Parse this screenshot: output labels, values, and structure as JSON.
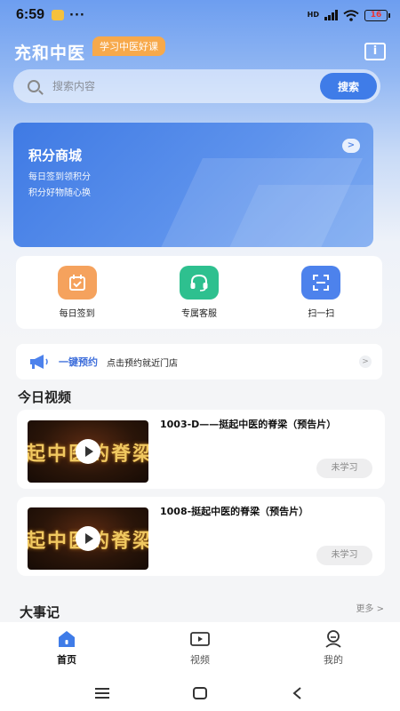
{
  "status_bar": {
    "time": "6:59",
    "dots": "···",
    "network": "HD",
    "battery": "16"
  },
  "header": {
    "title": "充和中医",
    "tag": "学习中医好课"
  },
  "search": {
    "placeholder": "搜索内容",
    "button": "搜索"
  },
  "mall": {
    "title": "积分商城",
    "line1": "每日签到领积分",
    "line2": "积分好物随心换"
  },
  "quick_actions": [
    {
      "label": "每日签到",
      "icon": "calendar-check-icon",
      "color": "#f5a25d"
    },
    {
      "label": "专属客服",
      "icon": "headset-icon",
      "color": "#2ec08f"
    },
    {
      "label": "扫一扫",
      "icon": "scan-icon",
      "color": "#4d82ec"
    }
  ],
  "appointment": {
    "title": "一键预约",
    "desc": "点击预约就近门店"
  },
  "today_videos": {
    "title": "今日视频",
    "items": [
      {
        "title": "1003-D——挺起中医的脊梁（预告片）",
        "thumb_text": "起中医的脊梁",
        "status": "未学习"
      },
      {
        "title": "1008-挺起中医的脊梁（预告片）",
        "thumb_text": "起中医的脊梁",
        "status": "未学习"
      }
    ]
  },
  "events": {
    "title": "大事记",
    "more": "更多"
  },
  "tabbar": [
    {
      "label": "首页",
      "icon": "home-icon",
      "active": true
    },
    {
      "label": "视频",
      "icon": "video-icon",
      "active": false
    },
    {
      "label": "我的",
      "icon": "user-icon",
      "active": false
    }
  ],
  "colors": {
    "primary": "#3f7ce8",
    "tag": "#f7a94b"
  }
}
